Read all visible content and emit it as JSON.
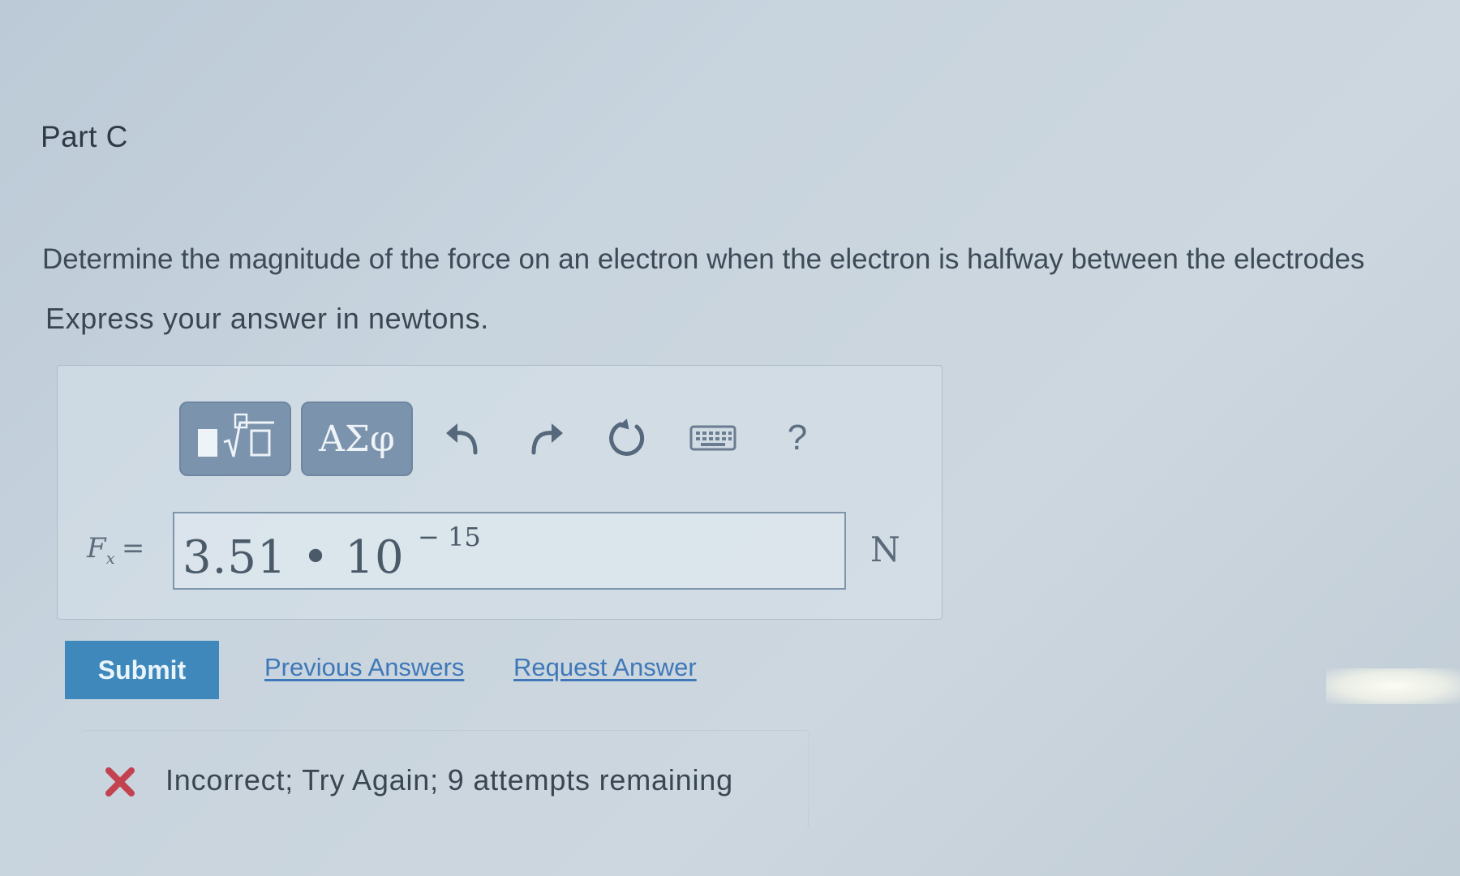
{
  "part": {
    "title": "Part C"
  },
  "question": {
    "prompt": "Determine the magnitude of the force on an electron when the electron is halfway between the electrodes",
    "instruction": "Express your answer in newtons."
  },
  "toolbar": {
    "templates_icon": "templates-sqrt-icon",
    "symbols_label": "ΑΣφ",
    "undo_icon": "undo-icon",
    "redo_icon": "redo-icon",
    "reset_icon": "reset-icon",
    "keyboard_icon": "keyboard-icon",
    "help_label": "?"
  },
  "answer": {
    "variable": "F",
    "subscript": "x",
    "equals": "=",
    "value_text": "3.51 • 10",
    "exponent": "− 15",
    "unit": "N"
  },
  "actions": {
    "submit_label": "Submit",
    "previous_answers_label": "Previous Answers",
    "request_answer_label": "Request Answer"
  },
  "feedback": {
    "icon": "incorrect-x-icon",
    "text": "Incorrect; Try Again; 9 attempts remaining",
    "color": "#c2434f"
  },
  "colors": {
    "toolbar_button": "#7b93ad",
    "submit": "#3f88bc",
    "link": "#3f78b8"
  }
}
